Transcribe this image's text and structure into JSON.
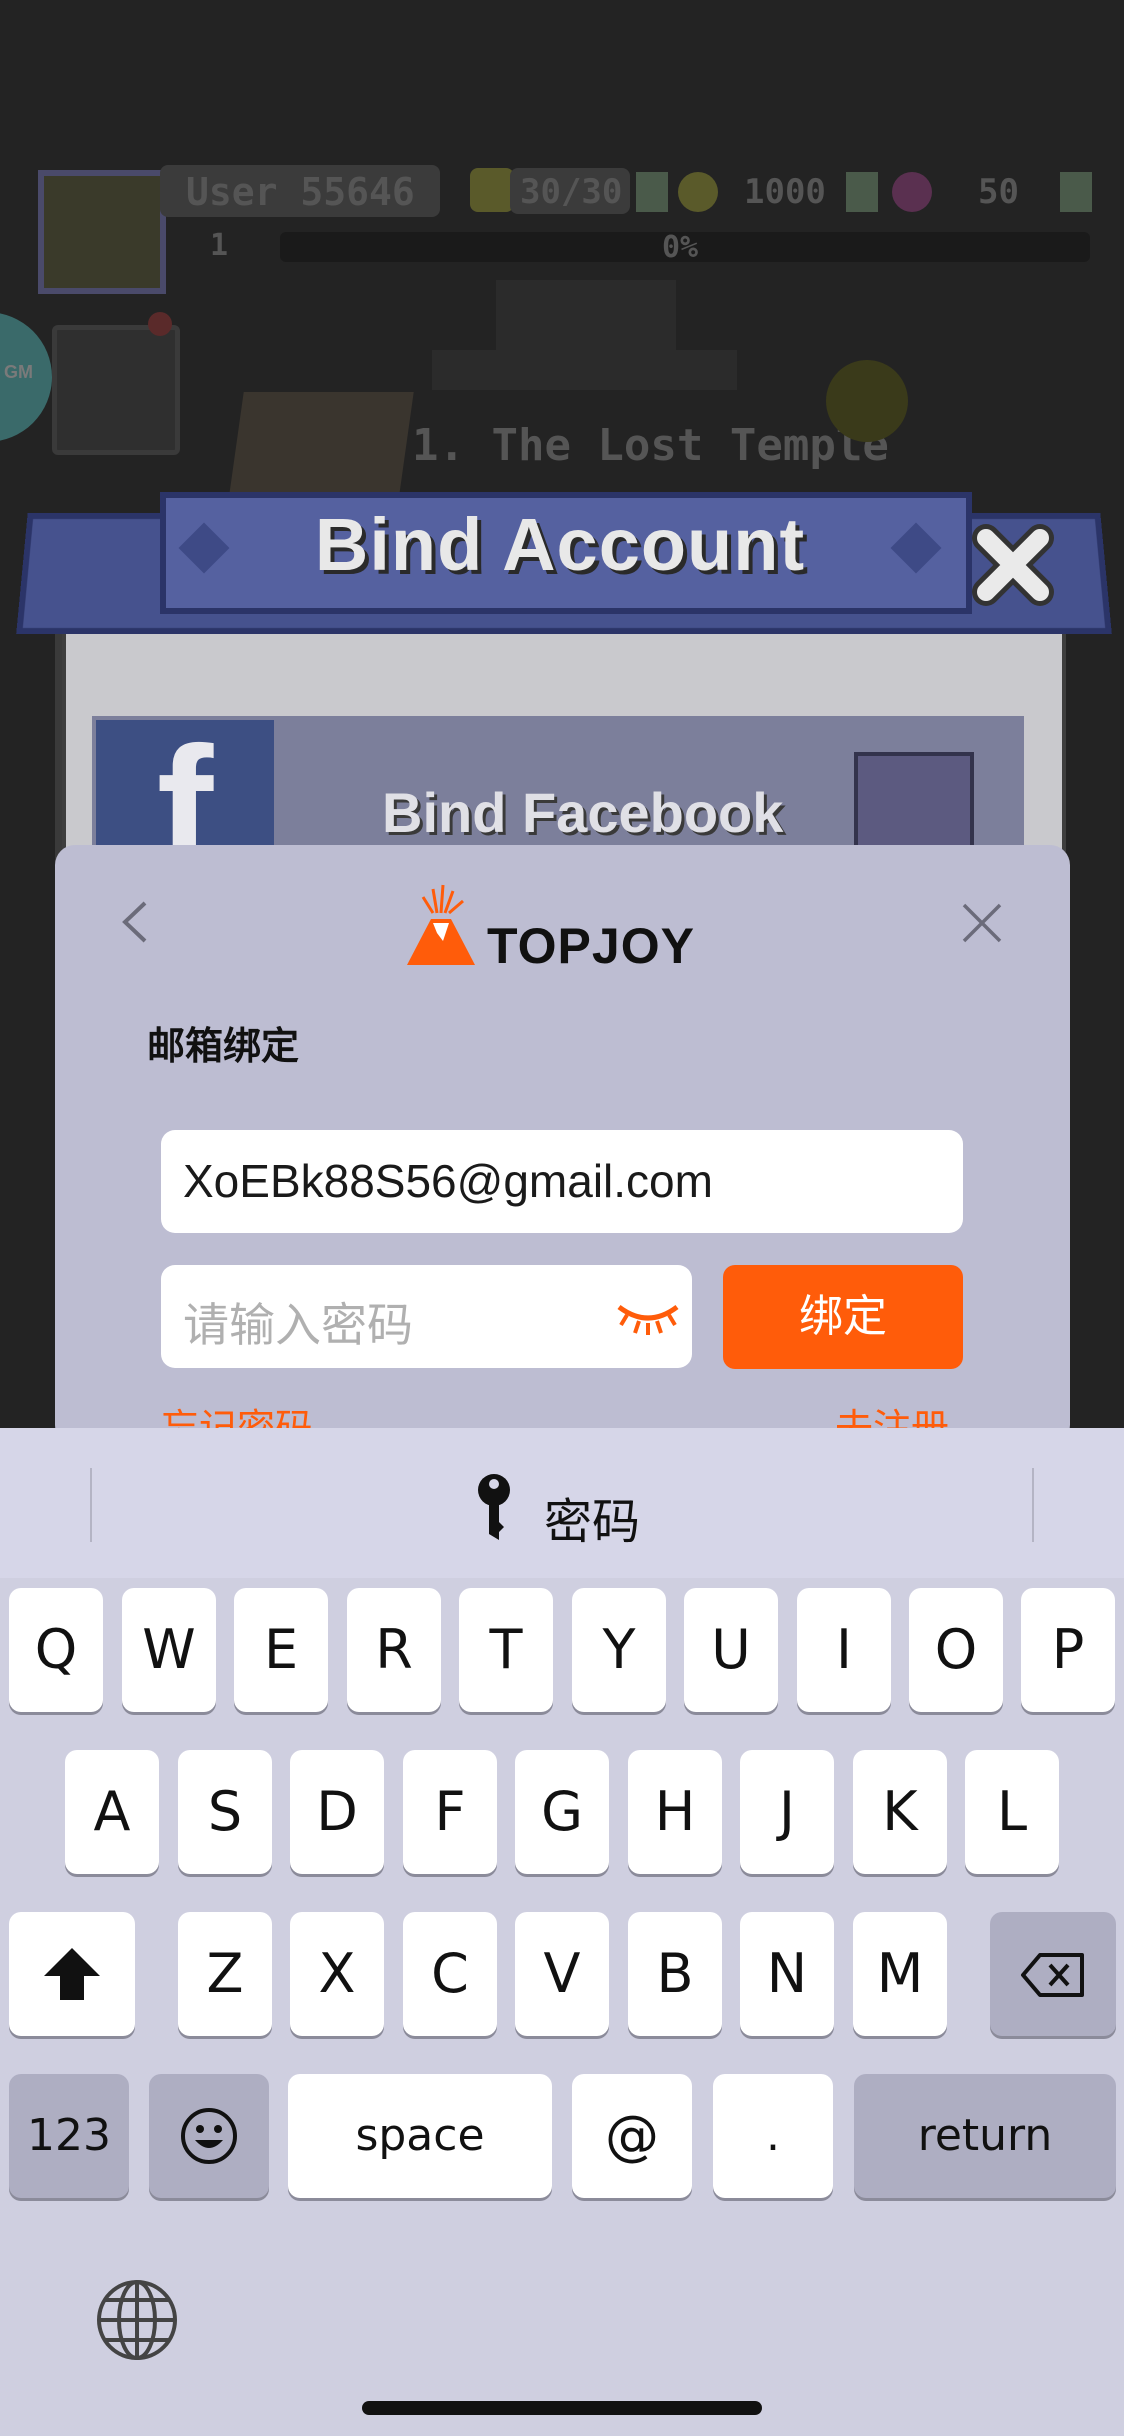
{
  "game": {
    "username": "User 55646",
    "energy": "30/30",
    "coins": "1000",
    "gems": "50",
    "level": "1",
    "progress_text": "0%",
    "progress_fraction": 0,
    "gm_badge": "GM",
    "quest_title": "1. The Lost Temple"
  },
  "bind_dialog": {
    "title": "Bind Account",
    "facebook_label": "Bind Facebook",
    "facebook_icon": "f"
  },
  "popup": {
    "brand": "TOPJOY",
    "heading": "邮箱绑定",
    "email_value": "XoEBk88S56@gmail.com",
    "password_placeholder": "请输入密码",
    "bind_button": "绑定",
    "forgot_link": "忘记密码",
    "register_link": "去注册",
    "accent_color": "#ff5c0a"
  },
  "keyboard": {
    "suggestion": "密码",
    "row1": [
      "Q",
      "W",
      "E",
      "R",
      "T",
      "Y",
      "U",
      "I",
      "O",
      "P"
    ],
    "row2": [
      "A",
      "S",
      "D",
      "F",
      "G",
      "H",
      "J",
      "K",
      "L"
    ],
    "row3": [
      "Z",
      "X",
      "C",
      "V",
      "B",
      "N",
      "M"
    ],
    "numbers_key": "123",
    "space_key": "space",
    "at_key": "@",
    "dot_key": ".",
    "return_key": "return"
  }
}
